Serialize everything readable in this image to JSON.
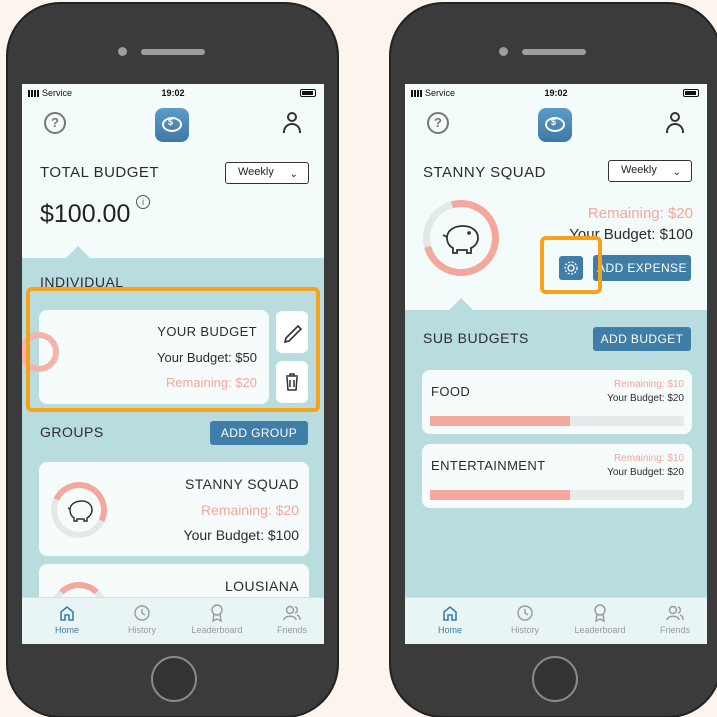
{
  "status": {
    "carrier": "Service",
    "time": "19:02"
  },
  "nav": [
    "Home",
    "History",
    "Leaderboard",
    "Friends"
  ],
  "left": {
    "title": "TOTAL BUDGET",
    "period": "Weekly",
    "amount": "$100.00",
    "info_glyph": "i",
    "individual_label": "INDIVIDUAL",
    "budget_card": {
      "title": "YOUR BUDGET",
      "budget": "Your Budget: $50",
      "remaining": "Remaining: $20"
    },
    "groups_label": "GROUPS",
    "add_group": "ADD GROUP",
    "group1": {
      "title": "STANNY SQUAD",
      "remaining": "Remaining: $20",
      "budget": "Your Budget: $100"
    },
    "group2": {
      "title": "LOUSIANA"
    }
  },
  "right": {
    "title": "STANNY SQUAD",
    "period": "Weekly",
    "remaining": "Remaining: $20",
    "budget": "Your Budget: $100",
    "add_expense": "ADD EXPENSE",
    "sub_label": "SUB BUDGETS",
    "add_budget": "ADD BUDGET",
    "food": {
      "title": "FOOD",
      "remaining": "Remaining: $10",
      "budget": "Your Budget: $20",
      "progress": 0.55
    },
    "entertainment": {
      "title": "ENTERTAINMENT",
      "remaining": "Remaining: $10",
      "budget": "Your Budget: $20",
      "progress": 0.55
    }
  },
  "colors": {
    "accent": "#3f7ea6",
    "highlight": "#f7a21b",
    "remaining": "#f4a79d",
    "panel": "#b9dcdf"
  }
}
